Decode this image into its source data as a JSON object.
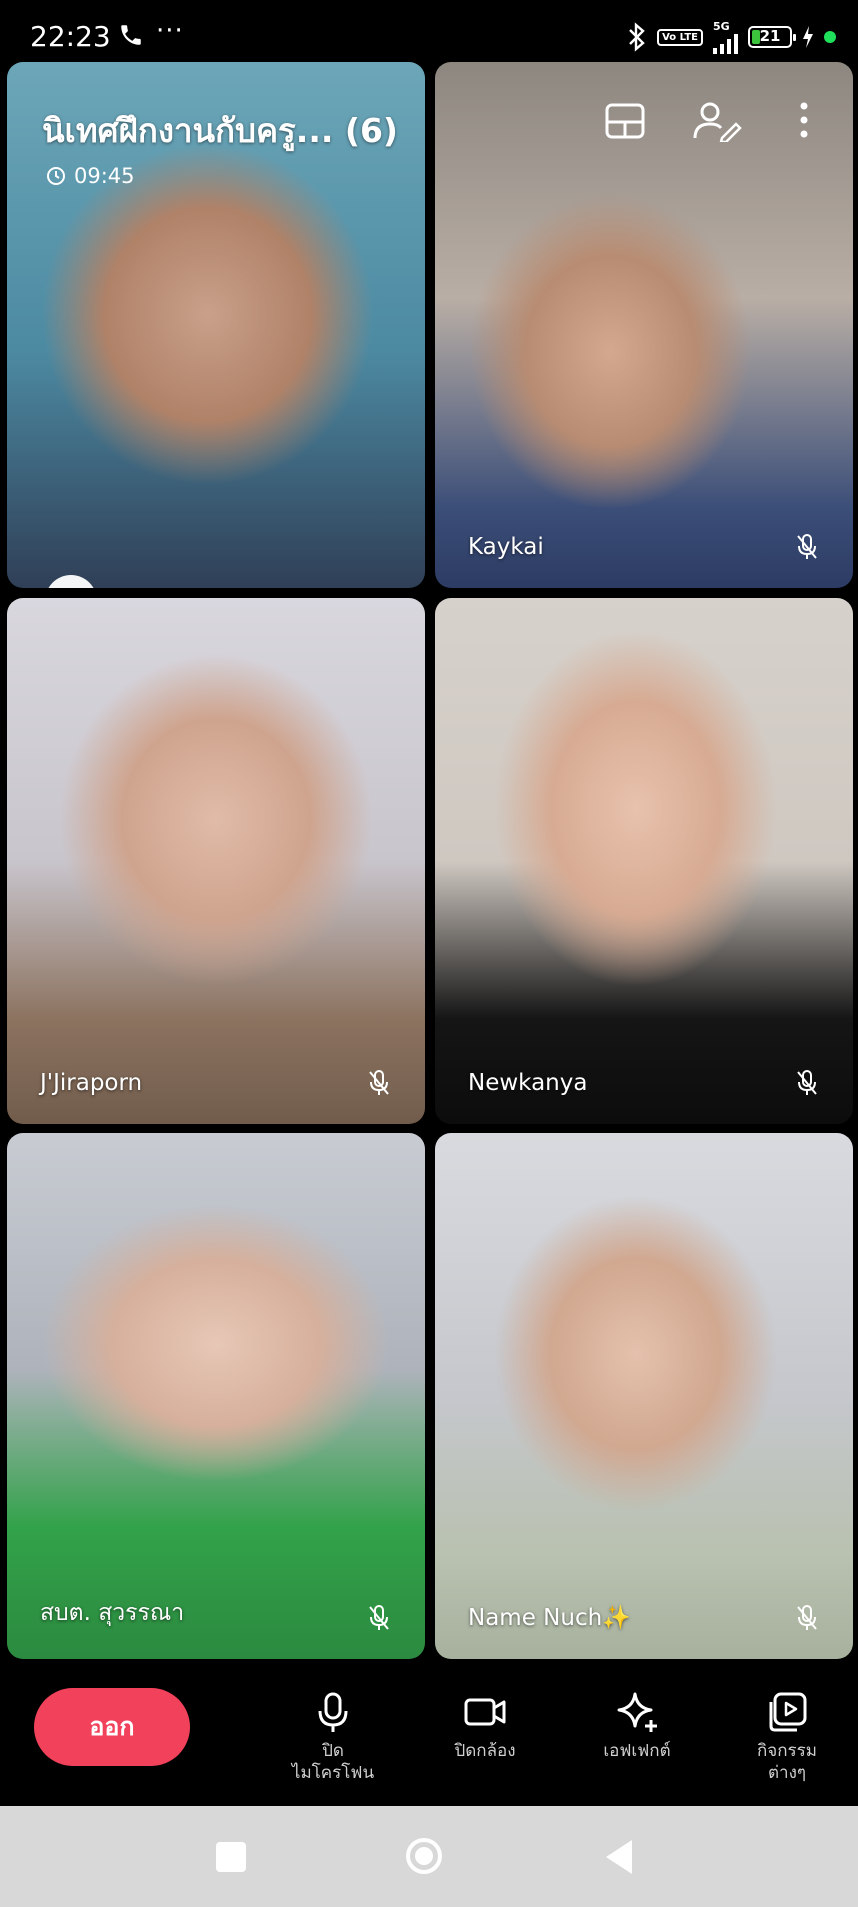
{
  "status_bar": {
    "time": "22:23",
    "more": "···",
    "network": "5G",
    "volte": "Vo LTE",
    "battery_level": "21",
    "battery_percent": 21,
    "icons": [
      "phone-icon",
      "bluetooth-icon",
      "signal-icon",
      "battery-icon",
      "charging-icon",
      "active-dot-icon"
    ]
  },
  "call": {
    "title": "นิเทศฝึกงานกับครู... (6)",
    "timer": "09:45"
  },
  "participants": [
    {
      "name": ""
    },
    {
      "name": "Kaykai"
    },
    {
      "name": "J'Jiraporn"
    },
    {
      "name": "Newkanya"
    },
    {
      "name": "สบต. สุวรรณา"
    },
    {
      "name": "Name Nuch✨"
    }
  ],
  "controls": {
    "leave": "ออก",
    "mic_line1": "ปิด",
    "mic_line2": "ไมโครโฟน",
    "camera": "ปิดกล้อง",
    "effects": "เอฟเฟกต์",
    "activities_line1": "กิจกรรม",
    "activities_line2": "ต่างๆ"
  },
  "colors": {
    "leave_button": "#f2415b",
    "background": "#000000",
    "nav_bar": "#d8d8d8",
    "battery_fill": "#3dc43d"
  }
}
